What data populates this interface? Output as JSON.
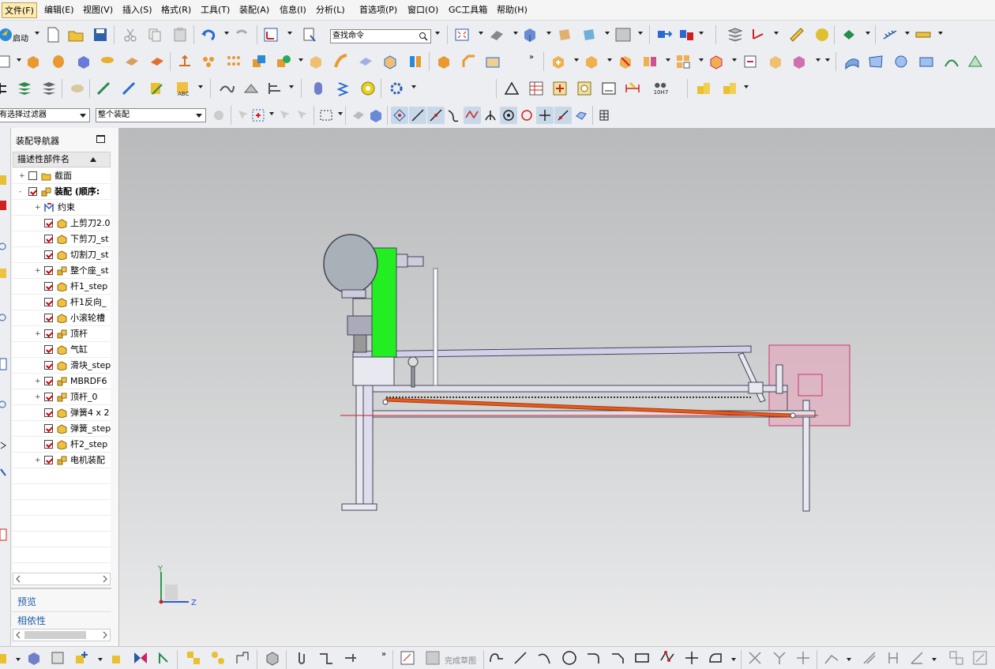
{
  "menu": {
    "items": [
      "文件(F)",
      "编辑(E)",
      "视图(V)",
      "插入(S)",
      "格式(R)",
      "工具(T)",
      "装配(A)",
      "信息(I)",
      "分析(L)",
      "首选项(P)",
      "窗口(O)",
      "GC工具箱",
      "帮助(H)"
    ],
    "active": "文件(F)"
  },
  "toolbar": {
    "launch_label": "启动",
    "find_command_placeholder": "查找命令",
    "filter_select": "有选择过滤器",
    "scope_select": "整个装配",
    "fit_label": "10H7"
  },
  "navigator": {
    "title": "装配导航器",
    "column_header": "描述性部件名",
    "items": [
      {
        "label": "截面",
        "level": 0,
        "expand": "+",
        "checked": false,
        "icon": "folder-icon"
      },
      {
        "label": "装配 (顺序:",
        "level": 0,
        "expand": "-",
        "checked": true,
        "icon": "assembly-icon",
        "bold": true
      },
      {
        "label": "约束",
        "level": 1,
        "expand": "+",
        "checked": null,
        "icon": "constraint-icon"
      },
      {
        "label": "上剪刀2.0",
        "level": 1,
        "expand": "",
        "checked": true,
        "icon": "part-icon"
      },
      {
        "label": "下剪刀_st",
        "level": 1,
        "expand": "",
        "checked": true,
        "icon": "part-icon"
      },
      {
        "label": "切割刀_st",
        "level": 1,
        "expand": "",
        "checked": true,
        "icon": "part-icon"
      },
      {
        "label": "整个座_st",
        "level": 1,
        "expand": "+",
        "checked": true,
        "icon": "assembly-icon"
      },
      {
        "label": "杆1_step",
        "level": 1,
        "expand": "",
        "checked": true,
        "icon": "part-icon"
      },
      {
        "label": "杆1反向_",
        "level": 1,
        "expand": "",
        "checked": true,
        "icon": "part-icon"
      },
      {
        "label": "小滚轮槽",
        "level": 1,
        "expand": "",
        "checked": true,
        "icon": "part-icon"
      },
      {
        "label": "顶杆",
        "level": 1,
        "expand": "+",
        "checked": true,
        "icon": "assembly-icon"
      },
      {
        "label": "气缸",
        "level": 1,
        "expand": "",
        "checked": true,
        "icon": "part-icon"
      },
      {
        "label": "滑块_step",
        "level": 1,
        "expand": "",
        "checked": true,
        "icon": "part-icon"
      },
      {
        "label": "MBRDF6",
        "level": 1,
        "expand": "+",
        "checked": true,
        "icon": "assembly-icon"
      },
      {
        "label": "顶杆_0",
        "level": 1,
        "expand": "+",
        "checked": true,
        "icon": "assembly-icon"
      },
      {
        "label": "弹簧4 x 2",
        "level": 1,
        "expand": "",
        "checked": true,
        "icon": "part-icon"
      },
      {
        "label": "弹簧_step",
        "level": 1,
        "expand": "",
        "checked": true,
        "icon": "part-icon"
      },
      {
        "label": "杆2_step",
        "level": 1,
        "expand": "",
        "checked": true,
        "icon": "part-icon"
      },
      {
        "label": "电机装配",
        "level": 1,
        "expand": "+",
        "checked": true,
        "icon": "assembly-icon"
      }
    ],
    "preview_label": "预览",
    "dependency_label": "相依性"
  },
  "viewport": {
    "triad_y": "Y",
    "triad_z": "Z"
  },
  "sketch": {
    "finish_label": "完成草图"
  },
  "colors": {
    "accent": "#fcebb2",
    "motor_green": "#22ee22",
    "blade_orange": "#e85a1a",
    "highlight_pink": "#e8a0b8"
  }
}
